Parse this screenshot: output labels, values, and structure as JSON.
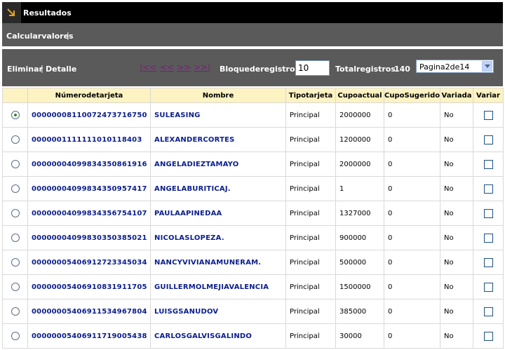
{
  "header": {
    "title": "Resultados"
  },
  "actions": {
    "calcular": "Calcular valores",
    "separator": "|"
  },
  "toolbar": {
    "eliminar": "Eliminar",
    "separator": "|",
    "detalle": "Detalle",
    "nav_first": "|<<",
    "nav_prev": "<<",
    "nav_next": ">>",
    "nav_last": ">>|",
    "bloque_label": "Bloque de registros:",
    "bloque_value": "10",
    "total_label": "Total registros:",
    "total_value": "140",
    "page_select": "Pagina 2 de 14"
  },
  "table": {
    "columns": [
      "",
      "Número de tarjeta",
      "Nombre",
      "Tipo tarjeta",
      "Cupo actual",
      "Cupo Sugerido",
      "Variada",
      "Variar"
    ],
    "selected_row": 0,
    "rows": [
      {
        "num": "0000000811007247371 6750",
        "name": "SULEASING",
        "tipo": "Principal",
        "cupo": "2000000",
        "sugerido": "0",
        "variada": "No"
      },
      {
        "num": "0000001111111010118403",
        "name": "ALEXANDER CORTES",
        "tipo": "Principal",
        "cupo": "1200000",
        "sugerido": "0",
        "variada": "No"
      },
      {
        "num": "0000000409983435086191 6",
        "name": "ANGELA DIEZ TAMAYO",
        "tipo": "Principal",
        "cupo": "2000000",
        "sugerido": "0",
        "variada": "No"
      },
      {
        "num": "0000000409983435095741 7",
        "name": "ANGELA BURITICA J.",
        "tipo": "Principal",
        "cupo": "1",
        "sugerido": "0",
        "variada": "No"
      },
      {
        "num": "0000000409983435675410 7",
        "name": "PAULA A PINEDA A",
        "tipo": "Principal",
        "cupo": "1327000",
        "sugerido": "0",
        "variada": "No"
      },
      {
        "num": "0000000409983035038502 1",
        "name": "NICOLAS LOPEZ A.",
        "tipo": "Principal",
        "cupo": "900000",
        "sugerido": "0",
        "variada": "No"
      },
      {
        "num": "0000000540691272334503 4",
        "name": "NANCY VIVIANA MUNERA M.",
        "tipo": "Principal",
        "cupo": "500000",
        "sugerido": "0",
        "variada": "No"
      },
      {
        "num": "0000000540691083191170 5",
        "name": "GUILLERMO L MEJIA VALENCIA",
        "tipo": "Principal",
        "cupo": "1500000",
        "sugerido": "0",
        "variada": "No"
      },
      {
        "num": "0000000540691153496780 4",
        "name": "LUIS G SANUDO V",
        "tipo": "Principal",
        "cupo": "385000",
        "sugerido": "0",
        "variada": "No"
      },
      {
        "num": "0000000540691171900543 8",
        "name": "CARLOS GALVIS GALINDO",
        "tipo": "Principal",
        "cupo": "30000",
        "sugerido": "0",
        "variada": "No"
      }
    ]
  }
}
